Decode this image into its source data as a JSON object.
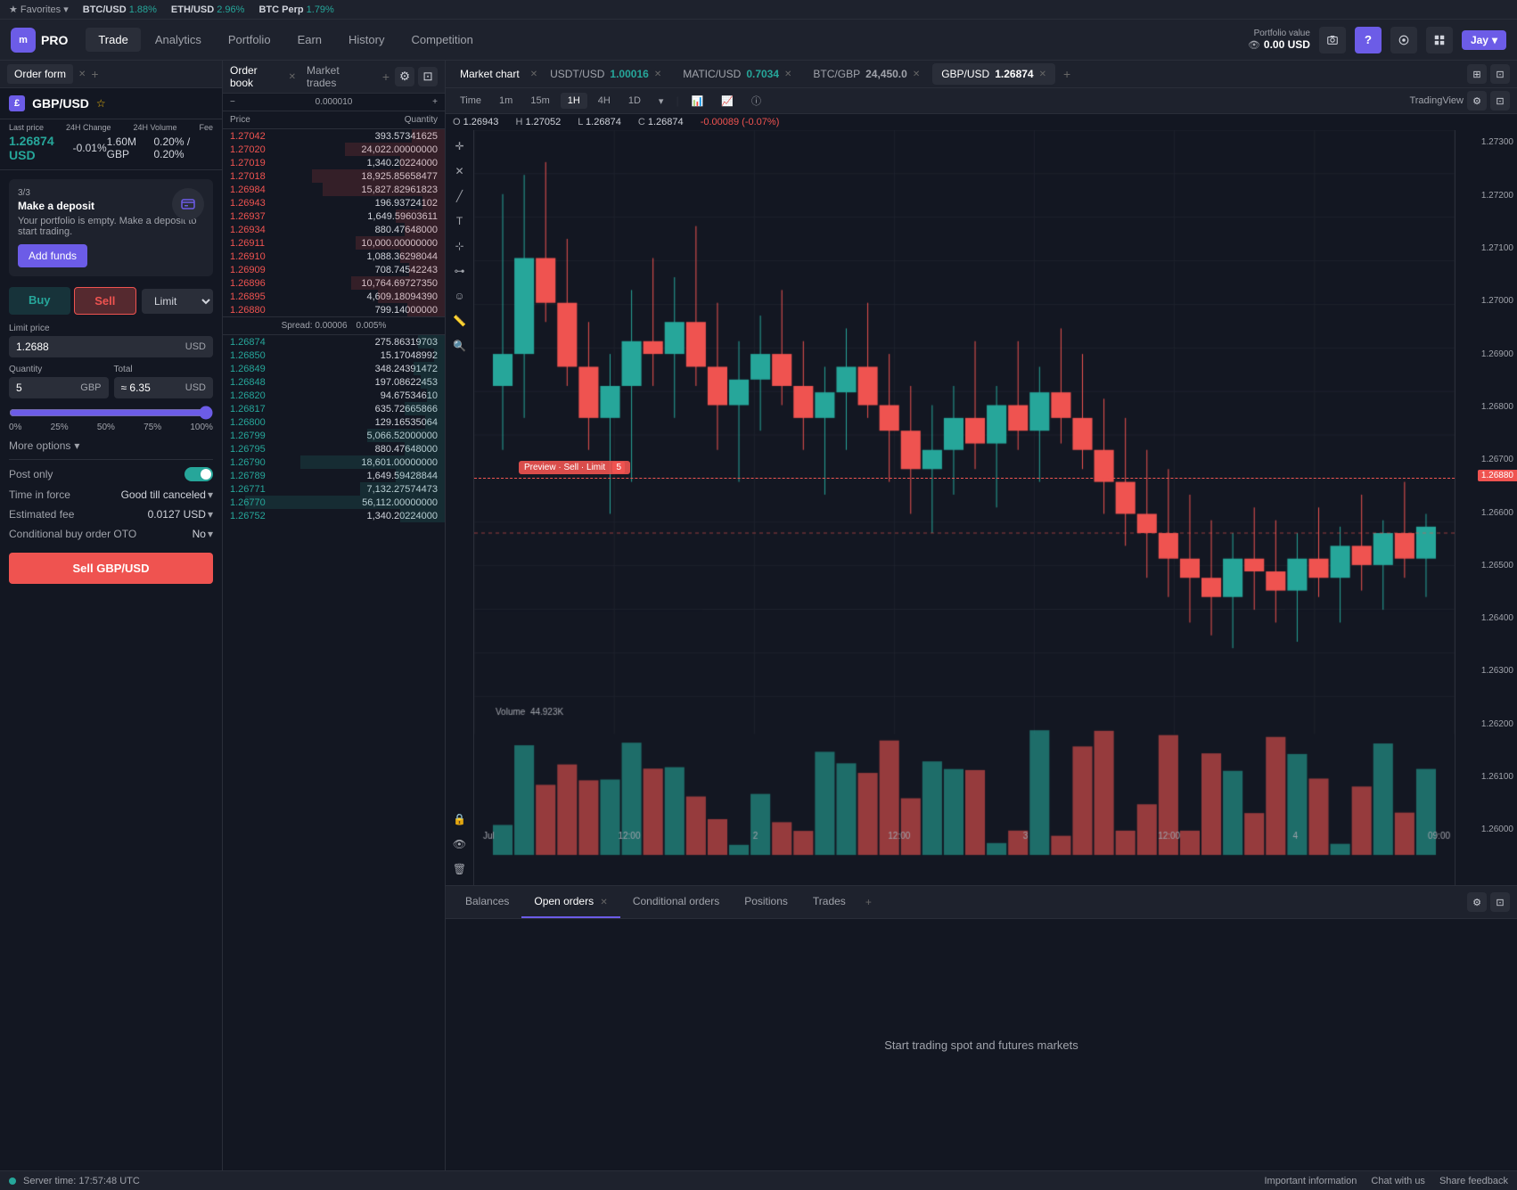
{
  "topBar": {
    "favorites": "Favorites",
    "pairs": [
      {
        "id": "btcusd",
        "name": "BTC/USD",
        "change": "1.88%",
        "direction": "up"
      },
      {
        "id": "ethusd",
        "name": "ETH/USD",
        "change": "2.96%",
        "direction": "up"
      },
      {
        "id": "btcperp",
        "name": "BTC Perp",
        "change": "1.79%",
        "direction": "up"
      }
    ]
  },
  "nav": {
    "logo": "PRO",
    "items": [
      {
        "id": "trade",
        "label": "Trade",
        "active": true
      },
      {
        "id": "analytics",
        "label": "Analytics",
        "active": false
      },
      {
        "id": "portfolio",
        "label": "Portfolio",
        "active": false
      },
      {
        "id": "earn",
        "label": "Earn",
        "active": false
      },
      {
        "id": "history",
        "label": "History",
        "active": false
      },
      {
        "id": "competition",
        "label": "Competition",
        "active": false
      }
    ],
    "portfolioLabel": "Portfolio value",
    "portfolioAmount": "0.00 USD",
    "user": "Jay"
  },
  "orderForm": {
    "tabLabel": "Order form",
    "pairFlag": "£",
    "pairName": "GBP/USD",
    "lastPrice": "1.26874 USD",
    "change24h": "-0.01%",
    "volume24h": "1.60M GBP",
    "fee": "0.20% / 0.20%",
    "deposit": {
      "step": "3/3",
      "title": "Make a deposit",
      "desc": "Your portfolio is empty. Make a deposit to start trading.",
      "btnLabel": "Add funds"
    },
    "buyLabel": "Buy",
    "sellLabel": "Sell",
    "orderType": "Limit",
    "limitPriceLabel": "Limit price",
    "limitPrice": "1.2688",
    "limitPriceUnit": "USD",
    "quantityLabel": "Quantity",
    "quantity": "5",
    "quantityUnit": "GBP",
    "totalLabel": "Total",
    "total": "≈ 6.35",
    "totalUnit": "USD",
    "sliderValue": "100%",
    "moreOptions": "More options",
    "options": {
      "postOnly": "Post only",
      "postOnlyValue": true,
      "timeInForce": "Time in force",
      "timeInForceValue": "Good till canceled",
      "estimatedFee": "Estimated fee",
      "estimatedFeeValue": "0.0127 USD",
      "conditionalBuy": "Conditional buy order OTO",
      "conditionalBuyValue": "No"
    },
    "sellBtnLabel": "Sell GBP/USD"
  },
  "orderBook": {
    "title": "Order book",
    "marketTradesLabel": "Market trades",
    "priceHeader": "Price",
    "quantityHeader": "Quantity",
    "spread": "Spread: 0.00006",
    "spreadPct": "0.005%",
    "asks": [
      {
        "price": "1.27042",
        "qty": "393.57341625",
        "depth": 15
      },
      {
        "price": "1.27020",
        "qty": "24,022.00000000",
        "depth": 45
      },
      {
        "price": "1.27019",
        "qty": "1,340.20224000",
        "depth": 20
      },
      {
        "price": "1.27018",
        "qty": "18,925.85658477",
        "depth": 60
      },
      {
        "price": "1.26984",
        "qty": "15,827.82961823",
        "depth": 55
      },
      {
        "price": "1.26943",
        "qty": "196.93724102",
        "depth": 10
      },
      {
        "price": "1.26937",
        "qty": "1,649.59603611",
        "depth": 22
      },
      {
        "price": "1.26934",
        "qty": "880.47648000",
        "depth": 18
      },
      {
        "price": "1.26911",
        "qty": "10,000.00000000",
        "depth": 40
      },
      {
        "price": "1.26910",
        "qty": "1,088.36298044",
        "depth": 20
      },
      {
        "price": "1.26909",
        "qty": "708.74542243",
        "depth": 16
      },
      {
        "price": "1.26896",
        "qty": "10,764.69727350",
        "depth": 42
      },
      {
        "price": "1.26895",
        "qty": "4,609.18094390",
        "depth": 30
      },
      {
        "price": "1.26880",
        "qty": "799.14000000",
        "depth": 17
      }
    ],
    "bids": [
      {
        "price": "1.26874",
        "qty": "275.86319703",
        "depth": 12
      },
      {
        "price": "1.26850",
        "qty": "15.17048992",
        "depth": 5
      },
      {
        "price": "1.26849",
        "qty": "348.24391472",
        "depth": 14
      },
      {
        "price": "1.26848",
        "qty": "197.08622453",
        "depth": 11
      },
      {
        "price": "1.26820",
        "qty": "94.67534610",
        "depth": 8
      },
      {
        "price": "1.26817",
        "qty": "635.72665866",
        "depth": 18
      },
      {
        "price": "1.26800",
        "qty": "129.16535064",
        "depth": 9
      },
      {
        "price": "1.26799",
        "qty": "5,066.52000000",
        "depth": 35
      },
      {
        "price": "1.26795",
        "qty": "880.47648000",
        "depth": 18
      },
      {
        "price": "1.26790",
        "qty": "18,601.00000000",
        "depth": 65
      },
      {
        "price": "1.26789",
        "qty": "1,649.59428844",
        "depth": 22
      },
      {
        "price": "1.26771",
        "qty": "7,132.27574473",
        "depth": 38
      },
      {
        "price": "1.26770",
        "qty": "56,112.00000000",
        "depth": 90
      },
      {
        "price": "1.26752",
        "qty": "1,340.20224000",
        "depth": 20
      }
    ]
  },
  "chart": {
    "title": "Market chart",
    "tabs": [
      {
        "id": "usdtusd",
        "pair": "USDT/USD",
        "price": "1.00016",
        "dir": "up",
        "close": true
      },
      {
        "id": "maticusd",
        "pair": "MATIC/USD",
        "price": "0.7034",
        "dir": "up",
        "close": true
      },
      {
        "id": "btcgbp",
        "pair": "BTC/GBP",
        "price": "24,450.0",
        "dir": "neutral",
        "close": true
      },
      {
        "id": "gbpusd",
        "pair": "GBP/USD",
        "price": "1.26874",
        "dir": "neutral",
        "close": true,
        "active": true
      }
    ],
    "timeframes": [
      "Time",
      "1m",
      "15m",
      "1H",
      "4H",
      "1D"
    ],
    "activeTimeframe": "1H",
    "source": "TradingView",
    "ohlc": {
      "o": "1.26943",
      "h": "1.27052",
      "l": "1.26874",
      "c": "1.26874",
      "chg": "-0.00089 (-0.07%)"
    },
    "previewLabel": "Preview · Sell · Limit",
    "previewNum": "5",
    "priceLines": [
      "1.27300",
      "1.27200",
      "1.27100",
      "1.27000",
      "1.26900",
      "1.26800",
      "1.26700",
      "1.26600",
      "1.26500",
      "1.26400",
      "1.26300",
      "1.26200",
      "1.26100",
      "1.26000"
    ],
    "currentPrice": "1.26874",
    "currentPriceHighlight": "1.26880",
    "volumeLabel": "Volume",
    "volumeValue": "44.923K",
    "xLabels": [
      "Jul",
      "12:00",
      "2",
      "12:00",
      "3",
      "12:00",
      "4",
      "09:00"
    ]
  },
  "bottomPanel": {
    "tabs": [
      {
        "id": "balances",
        "label": "Balances"
      },
      {
        "id": "open-orders",
        "label": "Open orders",
        "badge": "×",
        "active": true
      },
      {
        "id": "conditional-orders",
        "label": "Conditional orders"
      },
      {
        "id": "positions",
        "label": "Positions"
      },
      {
        "id": "trades",
        "label": "Trades"
      }
    ],
    "emptyMessage": "Start trading spot and futures markets"
  },
  "statusBar": {
    "serverTime": "Server time: 17:57:48 UTC",
    "links": [
      "Important information",
      "Chat with us",
      "Share feedback"
    ]
  }
}
